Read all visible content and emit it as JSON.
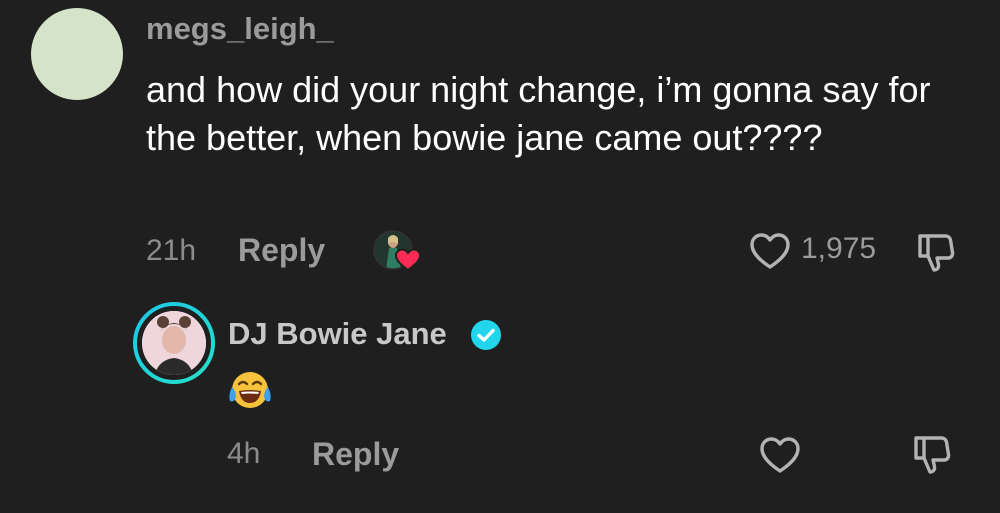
{
  "comment": {
    "username": "megs_leigh_",
    "text": "and how did your night change, i’m gonna say for the better, when bowie jane came out????",
    "time": "21h",
    "reply_label": "Reply",
    "like_count": "1,975",
    "avatar_color": "#d5e4c9",
    "creator_liked": true,
    "heart_badge_color": "#fe2c55"
  },
  "reply": {
    "username": "DJ Bowie Jane",
    "verified": true,
    "verified_color": "#20d5ec",
    "text": "😂",
    "time": "4h",
    "reply_label": "Reply",
    "avatar_ring_colors": [
      "#1fc6e8",
      "#20d5ec"
    ]
  },
  "icons": {
    "like": "heart-outline-icon",
    "dislike": "thumbs-down-outline-icon",
    "verified": "verified-check-icon"
  }
}
